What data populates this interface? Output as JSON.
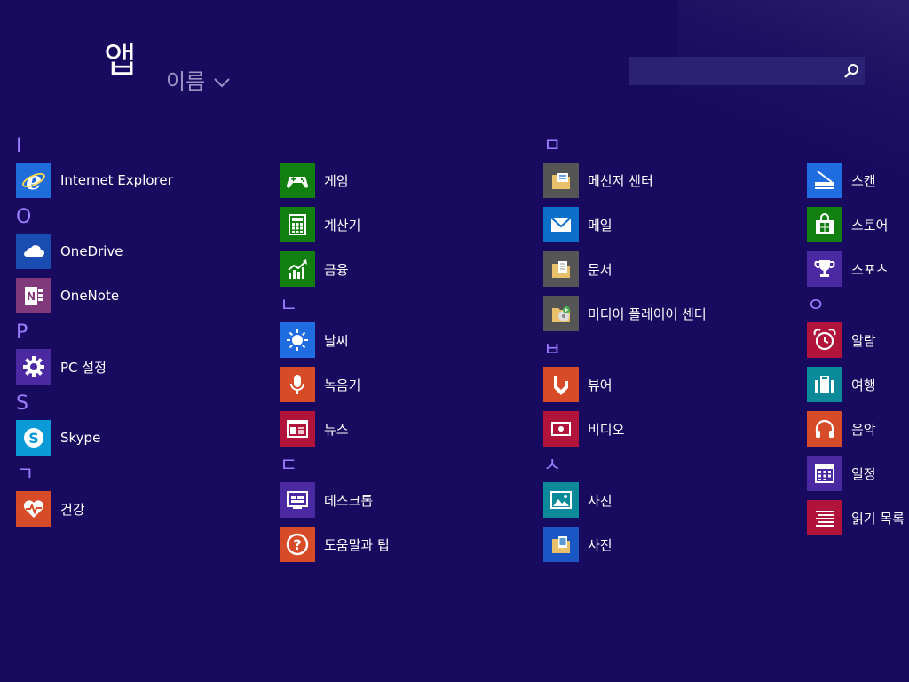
{
  "header": {
    "title": "앱",
    "sort_label": "이름",
    "search": {
      "value": "",
      "placeholder": ""
    }
  },
  "colors": {
    "background": "#180a5e",
    "header_letter": "#9d7dff",
    "sort_text": "#9b95c6",
    "search_bg": "#2c2275"
  },
  "columns": [
    {
      "groups": [
        {
          "letter": "I",
          "apps": [
            {
              "label": "Internet Explorer",
              "icon": "internet-explorer-icon",
              "color": "#1e6ddb"
            }
          ]
        },
        {
          "letter": "O",
          "apps": [
            {
              "label": "OneDrive",
              "icon": "cloud-icon",
              "color": "#1a4db1"
            },
            {
              "label": "OneNote",
              "icon": "onenote-icon",
              "color": "#80397b"
            }
          ]
        },
        {
          "letter": "P",
          "apps": [
            {
              "label": "PC 설정",
              "icon": "gear-icon",
              "color": "#4a29a3"
            }
          ]
        },
        {
          "letter": "S",
          "apps": [
            {
              "label": "Skype",
              "icon": "skype-icon",
              "color": "#0a9ad8"
            }
          ]
        },
        {
          "letter": "ㄱ",
          "apps": [
            {
              "label": "건강",
              "icon": "heart-pulse-icon",
              "color": "#d74b29"
            }
          ]
        }
      ]
    },
    {
      "groups": [
        {
          "letter": "",
          "apps": [
            {
              "label": "게임",
              "icon": "game-controller-icon",
              "color": "#118010"
            },
            {
              "label": "계산기",
              "icon": "calculator-icon",
              "color": "#118010"
            },
            {
              "label": "금융",
              "icon": "finance-chart-icon",
              "color": "#118010"
            }
          ]
        },
        {
          "letter": "ㄴ",
          "apps": [
            {
              "label": "날씨",
              "icon": "sun-icon",
              "color": "#1f6de0"
            },
            {
              "label": "녹음기",
              "icon": "microphone-icon",
              "color": "#d74b29"
            },
            {
              "label": "뉴스",
              "icon": "news-icon",
              "color": "#b1133b"
            }
          ]
        },
        {
          "letter": "ㄷ",
          "apps": [
            {
              "label": "데스크톱",
              "icon": "desktop-icon",
              "color": "#4a29a3"
            },
            {
              "label": "도움말과 팁",
              "icon": "help-icon",
              "color": "#d74b29"
            }
          ]
        }
      ]
    },
    {
      "groups": [
        {
          "letter": "ㅁ",
          "apps": [
            {
              "label": "메신저 센터",
              "icon": "folder-icon",
              "color": "#555555"
            },
            {
              "label": "메일",
              "icon": "mail-icon",
              "color": "#0c6fc9"
            },
            {
              "label": "문서",
              "icon": "folder-icon",
              "color": "#555555"
            },
            {
              "label": "미디어 플레이어 센터",
              "icon": "folder-media-icon",
              "color": "#555555"
            }
          ]
        },
        {
          "letter": "ㅂ",
          "apps": [
            {
              "label": "뷰어",
              "icon": "reader-icon",
              "color": "#d74b29"
            },
            {
              "label": "비디오",
              "icon": "video-icon",
              "color": "#b1133b"
            }
          ]
        },
        {
          "letter": "ㅅ",
          "apps": [
            {
              "label": "사진",
              "icon": "photos-icon",
              "color": "#0b8a9a"
            },
            {
              "label": "사진",
              "icon": "folder-photos-icon",
              "color": "#1b57c4"
            }
          ]
        }
      ]
    },
    {
      "groups": [
        {
          "letter": "",
          "apps": [
            {
              "label": "스캔",
              "icon": "scanner-icon",
              "color": "#1f6de0"
            },
            {
              "label": "스토어",
              "icon": "store-icon",
              "color": "#118010"
            },
            {
              "label": "스포츠",
              "icon": "trophy-icon",
              "color": "#4a29a3"
            }
          ]
        },
        {
          "letter": "ㅇ",
          "apps": [
            {
              "label": "알람",
              "icon": "alarm-icon",
              "color": "#b1133b"
            },
            {
              "label": "여행",
              "icon": "suitcase-icon",
              "color": "#0b8a9a"
            },
            {
              "label": "음악",
              "icon": "headphones-icon",
              "color": "#d74b29"
            },
            {
              "label": "일정",
              "icon": "calendar-icon",
              "color": "#4a29a3"
            },
            {
              "label": "읽기 목록",
              "icon": "reading-list-icon",
              "color": "#b1133b"
            }
          ]
        }
      ]
    }
  ]
}
